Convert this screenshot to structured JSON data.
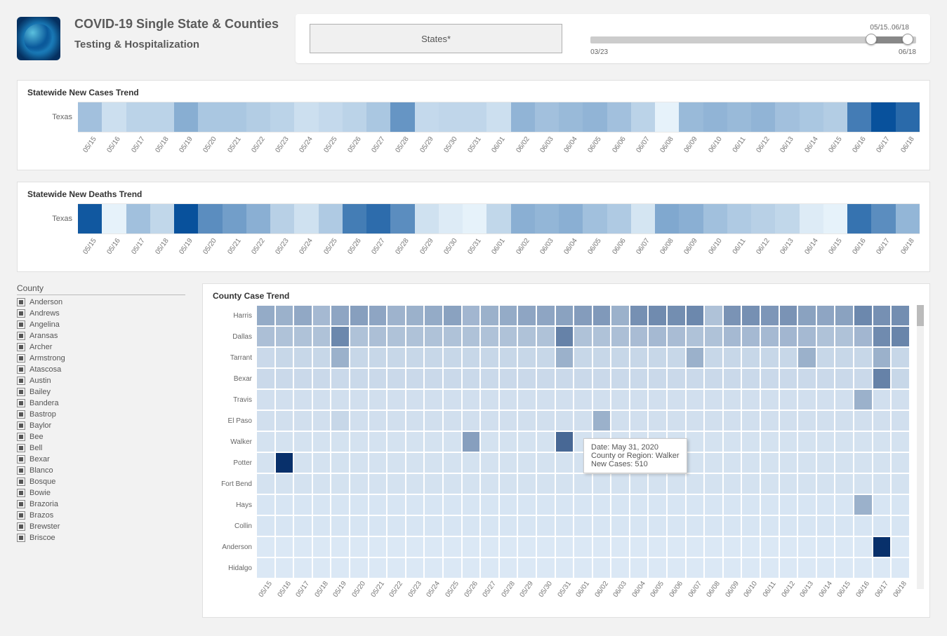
{
  "header": {
    "title": "COVID-19 Single State & Counties",
    "subtitle": "Testing & Hospitalization",
    "states_button_label": "States*",
    "slider": {
      "range_label": "05/15..06/18",
      "start_label": "03/23",
      "end_label": "06/18"
    }
  },
  "dates": [
    "05/15",
    "05/16",
    "05/17",
    "05/18",
    "05/19",
    "05/20",
    "05/21",
    "05/22",
    "05/23",
    "05/24",
    "05/25",
    "05/26",
    "05/27",
    "05/28",
    "05/29",
    "05/30",
    "05/31",
    "06/01",
    "06/02",
    "06/03",
    "06/04",
    "06/05",
    "06/06",
    "06/07",
    "06/08",
    "06/09",
    "06/10",
    "06/11",
    "06/12",
    "06/13",
    "06/14",
    "06/15",
    "06/16",
    "06/17",
    "06/18"
  ],
  "chart_data": [
    {
      "type": "heatmap",
      "title": "Statewide New Cases Trend",
      "ylabel": "Texas",
      "x": [
        "05/15",
        "05/16",
        "05/17",
        "05/18",
        "05/19",
        "05/20",
        "05/21",
        "05/22",
        "05/23",
        "05/24",
        "05/25",
        "05/26",
        "05/27",
        "05/28",
        "05/29",
        "05/30",
        "05/31",
        "06/01",
        "06/02",
        "06/03",
        "06/04",
        "06/05",
        "06/06",
        "06/07",
        "06/08",
        "06/09",
        "06/10",
        "06/11",
        "06/12",
        "06/13",
        "06/14",
        "06/15",
        "06/16",
        "06/17",
        "06/18"
      ],
      "values": [
        1400,
        900,
        1100,
        1100,
        1700,
        1300,
        1300,
        1200,
        1100,
        900,
        1000,
        1100,
        1300,
        2100,
        1000,
        1050,
        1050,
        900,
        1600,
        1400,
        1500,
        1600,
        1400,
        1100,
        600,
        1500,
        1600,
        1500,
        1600,
        1400,
        1300,
        1200,
        2500,
        3200,
        2800
      ],
      "color_scale": {
        "min": 600,
        "max": 3200,
        "low_color": "#e6f2fa",
        "high_color": "#08519c"
      }
    },
    {
      "type": "heatmap",
      "title": "Statewide New Deaths Trend",
      "ylabel": "Texas",
      "x": [
        "05/15",
        "05/16",
        "05/17",
        "05/18",
        "05/19",
        "05/20",
        "05/21",
        "05/22",
        "05/23",
        "05/24",
        "05/25",
        "05/26",
        "05/27",
        "05/28",
        "05/29",
        "05/30",
        "05/31",
        "06/01",
        "06/02",
        "06/03",
        "06/04",
        "06/05",
        "06/06",
        "06/07",
        "06/08",
        "06/09",
        "06/10",
        "06/11",
        "06/12",
        "06/13",
        "06/14",
        "06/15",
        "06/16",
        "06/17",
        "06/18"
      ],
      "values": [
        56,
        10,
        25,
        18,
        58,
        40,
        35,
        30,
        20,
        15,
        22,
        45,
        50,
        40,
        15,
        12,
        10,
        18,
        30,
        28,
        30,
        25,
        22,
        14,
        32,
        30,
        25,
        22,
        20,
        18,
        12,
        10,
        48,
        40,
        28
      ],
      "color_scale": {
        "min": 10,
        "max": 58,
        "low_color": "#e6f2fa",
        "high_color": "#08519c"
      }
    },
    {
      "type": "heatmap",
      "title": "County Case Trend",
      "x": [
        "05/15",
        "05/16",
        "05/17",
        "05/18",
        "05/19",
        "05/20",
        "05/21",
        "05/22",
        "05/23",
        "05/24",
        "05/25",
        "05/26",
        "05/27",
        "05/28",
        "05/29",
        "05/30",
        "05/31",
        "06/01",
        "06/02",
        "06/03",
        "06/04",
        "06/05",
        "06/06",
        "06/07",
        "06/08",
        "06/09",
        "06/10",
        "06/11",
        "06/12",
        "06/13",
        "06/14",
        "06/15",
        "06/16",
        "06/17",
        "06/18"
      ],
      "y": [
        "Harris",
        "Dallas",
        "Tarrant",
        "Bexar",
        "Travis",
        "El Paso",
        "Walker",
        "Potter",
        "Fort Bend",
        "Hays",
        "Collin",
        "Anderson",
        "Hidalgo"
      ],
      "series": [
        {
          "name": "Harris",
          "values": [
            280,
            260,
            290,
            230,
            300,
            320,
            300,
            250,
            260,
            280,
            310,
            240,
            260,
            280,
            300,
            300,
            310,
            330,
            340,
            260,
            370,
            390,
            380,
            400,
            200,
            360,
            370,
            350,
            360,
            310,
            300,
            310,
            400,
            370,
            380
          ]
        },
        {
          "name": "Dallas",
          "values": [
            210,
            200,
            200,
            200,
            400,
            200,
            210,
            200,
            200,
            200,
            200,
            200,
            200,
            200,
            200,
            200,
            420,
            200,
            200,
            210,
            220,
            230,
            220,
            200,
            200,
            230,
            230,
            230,
            240,
            230,
            200,
            200,
            240,
            390,
            410
          ]
        },
        {
          "name": "Tarrant",
          "values": [
            120,
            130,
            130,
            130,
            260,
            130,
            130,
            130,
            130,
            130,
            130,
            130,
            130,
            130,
            130,
            130,
            260,
            130,
            130,
            130,
            130,
            130,
            130,
            260,
            130,
            130,
            130,
            130,
            130,
            260,
            130,
            130,
            130,
            260,
            130
          ]
        },
        {
          "name": "Bexar",
          "values": [
            120,
            120,
            120,
            120,
            120,
            120,
            120,
            120,
            120,
            120,
            120,
            120,
            120,
            120,
            120,
            120,
            120,
            120,
            120,
            120,
            120,
            120,
            120,
            120,
            120,
            120,
            120,
            120,
            120,
            120,
            120,
            120,
            120,
            420,
            130
          ]
        },
        {
          "name": "Travis",
          "values": [
            100,
            100,
            100,
            100,
            100,
            100,
            100,
            100,
            100,
            100,
            100,
            100,
            100,
            100,
            100,
            100,
            100,
            100,
            100,
            100,
            100,
            100,
            100,
            100,
            100,
            100,
            100,
            100,
            100,
            100,
            100,
            100,
            260,
            100,
            100
          ]
        },
        {
          "name": "El Paso",
          "values": [
            100,
            100,
            100,
            100,
            130,
            100,
            100,
            100,
            100,
            100,
            100,
            100,
            100,
            100,
            100,
            100,
            100,
            100,
            260,
            100,
            100,
            100,
            100,
            100,
            100,
            100,
            100,
            100,
            100,
            100,
            100,
            100,
            100,
            100,
            100
          ]
        },
        {
          "name": "Walker",
          "values": [
            90,
            90,
            90,
            90,
            90,
            90,
            90,
            90,
            90,
            90,
            90,
            320,
            90,
            90,
            90,
            90,
            510,
            90,
            90,
            90,
            90,
            90,
            90,
            90,
            90,
            90,
            90,
            90,
            90,
            90,
            90,
            90,
            90,
            90,
            90
          ]
        },
        {
          "name": "Potter",
          "values": [
            90,
            700,
            90,
            90,
            90,
            90,
            90,
            90,
            90,
            90,
            90,
            90,
            90,
            90,
            90,
            90,
            90,
            90,
            90,
            90,
            90,
            90,
            90,
            90,
            90,
            90,
            90,
            90,
            90,
            90,
            90,
            90,
            90,
            90,
            90
          ]
        },
        {
          "name": "Fort Bend",
          "values": [
            90,
            90,
            90,
            90,
            90,
            90,
            90,
            90,
            90,
            90,
            90,
            90,
            90,
            90,
            90,
            90,
            90,
            90,
            90,
            90,
            90,
            90,
            90,
            90,
            90,
            90,
            90,
            90,
            90,
            90,
            90,
            90,
            90,
            90,
            90
          ]
        },
        {
          "name": "Hays",
          "values": [
            80,
            80,
            80,
            80,
            80,
            80,
            80,
            80,
            80,
            80,
            80,
            80,
            80,
            80,
            80,
            80,
            80,
            80,
            80,
            80,
            80,
            80,
            80,
            80,
            80,
            80,
            80,
            80,
            80,
            80,
            80,
            80,
            260,
            80,
            80
          ]
        },
        {
          "name": "Collin",
          "values": [
            80,
            80,
            80,
            80,
            80,
            80,
            80,
            80,
            80,
            80,
            80,
            80,
            80,
            80,
            80,
            80,
            80,
            80,
            80,
            80,
            80,
            80,
            80,
            80,
            80,
            80,
            80,
            80,
            80,
            80,
            80,
            80,
            80,
            80,
            80
          ]
        },
        {
          "name": "Anderson",
          "values": [
            70,
            70,
            70,
            70,
            70,
            70,
            70,
            70,
            70,
            70,
            70,
            70,
            70,
            70,
            70,
            70,
            70,
            70,
            70,
            70,
            70,
            70,
            70,
            70,
            70,
            70,
            70,
            70,
            70,
            70,
            70,
            70,
            70,
            700,
            70
          ]
        },
        {
          "name": "Hidalgo",
          "values": [
            70,
            70,
            70,
            70,
            70,
            70,
            70,
            70,
            70,
            70,
            70,
            70,
            70,
            70,
            70,
            70,
            70,
            70,
            70,
            70,
            70,
            70,
            70,
            70,
            70,
            70,
            70,
            70,
            70,
            70,
            70,
            70,
            70,
            70,
            70
          ]
        }
      ],
      "color_scale": {
        "min": 60,
        "max": 700,
        "low_color": "#deebf7",
        "high_color": "#08306b"
      }
    }
  ],
  "tooltip": {
    "line1": "Date: May 31, 2020",
    "line2": "County or Region: Walker",
    "line3": "New Cases:  510"
  },
  "county_filter": {
    "title": "County",
    "items": [
      "Anderson",
      "Andrews",
      "Angelina",
      "Aransas",
      "Archer",
      "Armstrong",
      "Atascosa",
      "Austin",
      "Bailey",
      "Bandera",
      "Bastrop",
      "Baylor",
      "Bee",
      "Bell",
      "Bexar",
      "Blanco",
      "Bosque",
      "Bowie",
      "Brazoria",
      "Brazos",
      "Brewster",
      "Briscoe"
    ]
  }
}
